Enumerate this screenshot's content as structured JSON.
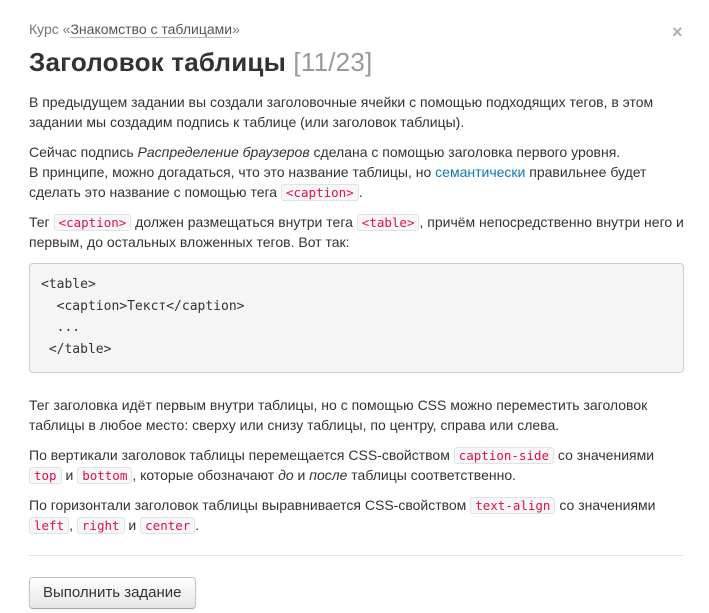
{
  "breadcrumb": {
    "prefix": "Курс «",
    "course_link": "Знакомство с таблицами",
    "suffix": "»"
  },
  "close_symbol": "×",
  "title": {
    "text": "Заголовок таблицы",
    "counter": "[11/23]"
  },
  "p1": "В предыдущем задании вы создали заголовочные ячейки с помощью подходящих тегов, в этом задании мы создадим подпись к таблице (или заголовок таблицы).",
  "p2": {
    "a": "Сейчас подпись ",
    "em": "Распределение браузеров",
    "b": " сделана с помощью заголовка первого уровня.",
    "c": "В принципе, можно догадаться, что это название таблицы, но ",
    "link": "семантически",
    "d": " правильнее будет сделать это название с помощью тега ",
    "code": "<caption>",
    "e": "."
  },
  "p3": {
    "a": "Тег ",
    "code1": "<caption>",
    "b": " должен размещаться внутри тега ",
    "code2": "<table>",
    "c": ", причём непосредственно внутри него и первым, до остальных вложенных тегов. Вот так:"
  },
  "code_block": "<table>\n  <caption>Текст</caption>\n  ...\n </table>",
  "p4": "Тег заголовка идёт первым внутри таблицы, но с помощью CSS можно переместить заголовок таблицы в любое место: сверху или снизу таблицы, по центру, справа или слева.",
  "p5": {
    "a": "По вертикали заголовок таблицы перемещается CSS-свойством ",
    "code1": "caption-side",
    "b": " со значениями ",
    "code2": "top",
    "c": " и ",
    "code3": "bottom",
    "d": ", которые обозначают ",
    "em1": "до",
    "e": " и ",
    "em2": "после",
    "f": " таблицы соответственно."
  },
  "p6": {
    "a": "По горизонтали заголовок таблицы выравнивается CSS-свойством ",
    "code1": "text-align",
    "b": " со значениями ",
    "code2": "left",
    "c": ", ",
    "code3": "right",
    "d": " и ",
    "code4": "center",
    "e": "."
  },
  "submit_button": "Выполнить задание",
  "colors": {
    "link": "#0e76b8",
    "code_text": "#dd1144",
    "code_bg": "#f7f7f9",
    "counter": "#999999"
  }
}
